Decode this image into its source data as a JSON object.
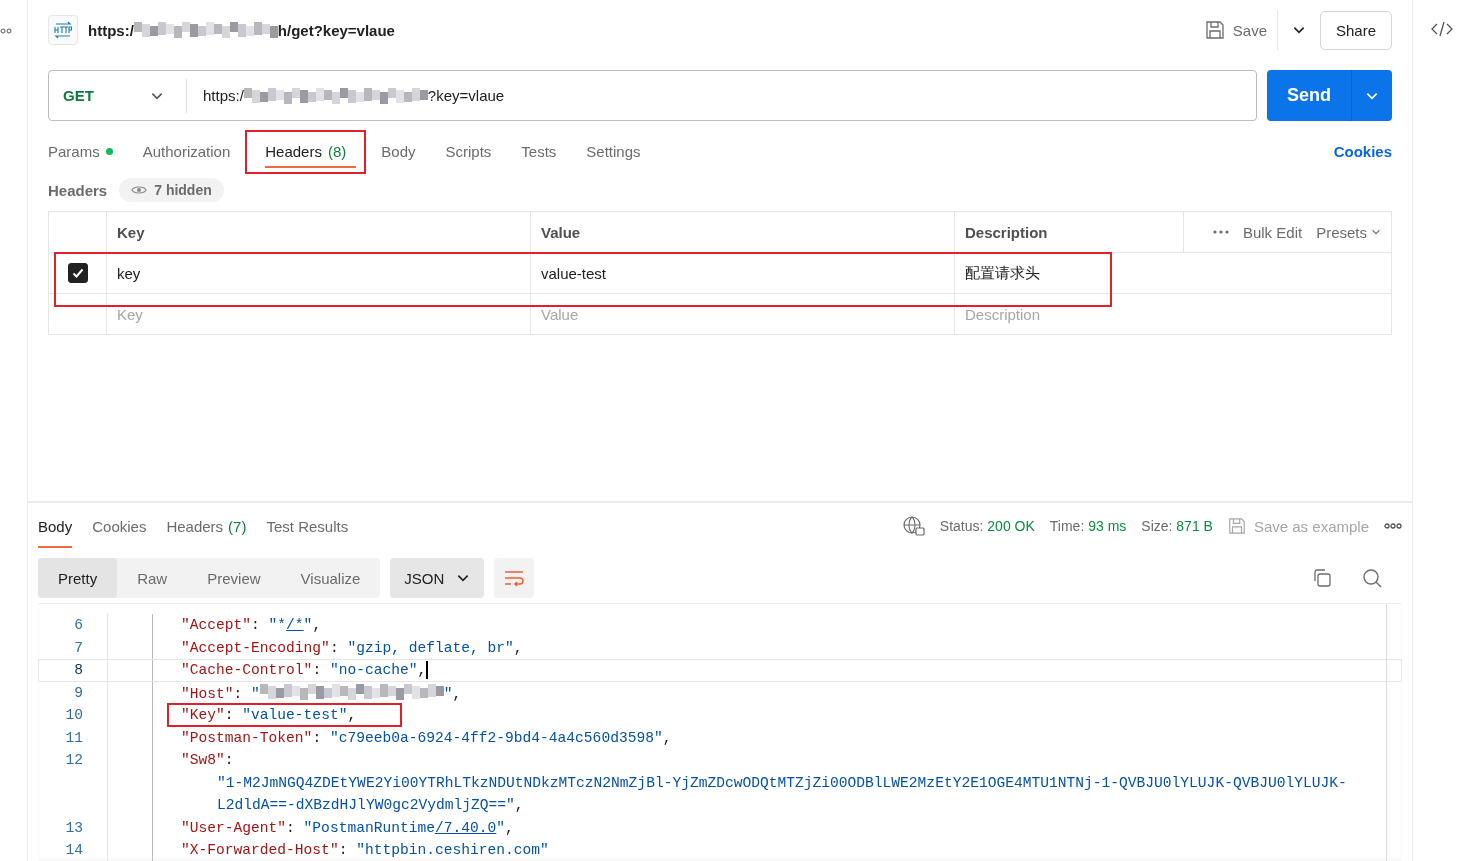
{
  "request": {
    "title": {
      "prefix": "https:/",
      "suffix": "h/get?key=vlaue"
    },
    "save_label": "Save",
    "share_label": "Share",
    "method": "GET",
    "url": {
      "prefix": "https:/",
      "suffix": "?key=vlaue"
    },
    "send_label": "Send"
  },
  "request_tabs": [
    {
      "label": "Params",
      "dot": true,
      "selected": false,
      "highlighted": false
    },
    {
      "label": "Authorization",
      "dot": false,
      "selected": false,
      "highlighted": false
    },
    {
      "label": "Headers",
      "count": "(8)",
      "dot": false,
      "selected": true,
      "highlighted": true
    },
    {
      "label": "Body",
      "dot": false,
      "selected": false,
      "highlighted": false
    },
    {
      "label": "Scripts",
      "dot": false,
      "selected": false,
      "highlighted": false
    },
    {
      "label": "Tests",
      "dot": false,
      "selected": false,
      "highlighted": false
    },
    {
      "label": "Settings",
      "dot": false,
      "selected": false,
      "highlighted": false
    }
  ],
  "cookies_link": "Cookies",
  "headers": {
    "title": "Headers",
    "hidden_badge": "7 hidden",
    "columns": [
      "Key",
      "Value",
      "Description"
    ],
    "bulk_edit": "Bulk Edit",
    "presets": "Presets",
    "rows": [
      {
        "checked": true,
        "key": "key",
        "value": "value-test",
        "description": "配置请求头",
        "highlighted": true
      }
    ],
    "new_row": {
      "key_placeholder": "Key",
      "value_placeholder": "Value",
      "description_placeholder": "Description"
    }
  },
  "response": {
    "tabs": [
      {
        "label": "Body",
        "selected": true
      },
      {
        "label": "Cookies",
        "selected": false
      },
      {
        "label": "Headers",
        "count": "(7)",
        "selected": false
      },
      {
        "label": "Test Results",
        "selected": false
      }
    ],
    "status_label": "Status:",
    "status": "200 OK",
    "time_label": "Time:",
    "time": "93 ms",
    "size_label": "Size:",
    "size": "871 B",
    "save_example": "Save as example",
    "views": [
      {
        "label": "Pretty",
        "selected": true
      },
      {
        "label": "Raw",
        "selected": false
      },
      {
        "label": "Preview",
        "selected": false
      },
      {
        "label": "Visualize",
        "selected": false
      }
    ],
    "format": "JSON",
    "code": [
      {
        "kind": "entry",
        "number": "6",
        "current": false,
        "highlighted": false,
        "segments": [
          {
            "kind": "key",
            "text": "\"Accept\""
          },
          {
            "kind": "punct",
            "text": ": "
          },
          {
            "kind": "value",
            "text": "\"*"
          },
          {
            "kind": "link",
            "text": "/*"
          },
          {
            "kind": "value",
            "text": "\""
          },
          {
            "kind": "punct",
            "text": ","
          }
        ]
      },
      {
        "kind": "entry",
        "number": "7",
        "current": false,
        "highlighted": false,
        "segments": [
          {
            "kind": "key",
            "text": "\"Accept-Encoding\""
          },
          {
            "kind": "punct",
            "text": ": "
          },
          {
            "kind": "value",
            "text": "\"gzip, deflate, br\""
          },
          {
            "kind": "punct",
            "text": ","
          }
        ]
      },
      {
        "kind": "entry",
        "number": "8",
        "current": true,
        "highlighted": false,
        "segments": [
          {
            "kind": "key",
            "text": "\"Cache-Control\""
          },
          {
            "kind": "punct",
            "text": ": "
          },
          {
            "kind": "value",
            "text": "\"no-cache\""
          },
          {
            "kind": "punct",
            "text": ","
          }
        ]
      },
      {
        "kind": "entry",
        "number": "9",
        "current": false,
        "highlighted": false,
        "segments": [
          {
            "kind": "key",
            "text": "\"Host\""
          },
          {
            "kind": "punct",
            "text": ": "
          },
          {
            "kind": "value",
            "text": "\""
          },
          {
            "kind": "redacted"
          },
          {
            "kind": "value",
            "text": "\""
          },
          {
            "kind": "punct",
            "text": ","
          }
        ]
      },
      {
        "kind": "entry",
        "number": "10",
        "current": false,
        "highlighted": true,
        "segments": [
          {
            "kind": "key",
            "text": "\"Key\""
          },
          {
            "kind": "punct",
            "text": ": "
          },
          {
            "kind": "value",
            "text": "\"value-test\""
          },
          {
            "kind": "punct",
            "text": ","
          }
        ]
      },
      {
        "kind": "entry",
        "number": "11",
        "current": false,
        "highlighted": false,
        "segments": [
          {
            "kind": "key",
            "text": "\"Postman-Token\""
          },
          {
            "kind": "punct",
            "text": ": "
          },
          {
            "kind": "value",
            "text": "\"c79eeb0a-6924-4ff2-9bd4-4a4c560d3598\""
          },
          {
            "kind": "punct",
            "text": ","
          }
        ]
      },
      {
        "kind": "entry",
        "number": "12",
        "current": false,
        "highlighted": false,
        "segments": [
          {
            "kind": "key",
            "text": "\"Sw8\""
          },
          {
            "kind": "punct",
            "text": ":"
          }
        ]
      },
      {
        "kind": "wrap",
        "current": false,
        "highlighted": false,
        "segments": [
          {
            "kind": "value",
            "text": "\"1-M2JmNGQ4ZDEtYWE2Yi00YTRhLTkzNDUtNDkzMTczN2NmZjBl-YjZmZDcwODQtMTZjZi00ODBlLWE2MzEtY2E1OGE4MTU1NTNj-1-QVBJU0lYLUJK-QVBJU0lYLUJK-"
          }
        ]
      },
      {
        "kind": "wrap",
        "current": false,
        "highlighted": false,
        "segments": [
          {
            "kind": "value",
            "text": "L2dldA==-dXBzdHJlYW0gc2VydmljZQ==\""
          },
          {
            "kind": "punct",
            "text": ","
          }
        ]
      },
      {
        "kind": "entry",
        "number": "13",
        "current": false,
        "highlighted": false,
        "segments": [
          {
            "kind": "key",
            "text": "\"User-Agent\""
          },
          {
            "kind": "punct",
            "text": ": "
          },
          {
            "kind": "value",
            "text": "\"PostmanRuntime"
          },
          {
            "kind": "link",
            "text": "/7.40.0"
          },
          {
            "kind": "value",
            "text": "\""
          },
          {
            "kind": "punct",
            "text": ","
          }
        ]
      },
      {
        "kind": "entry",
        "number": "14",
        "current": false,
        "highlighted": false,
        "segments": [
          {
            "kind": "key",
            "text": "\"X-Forwarded-Host\""
          },
          {
            "kind": "punct",
            "text": ": "
          },
          {
            "kind": "value",
            "text": "\"httpbin.ceshiren.com\""
          }
        ]
      }
    ]
  }
}
